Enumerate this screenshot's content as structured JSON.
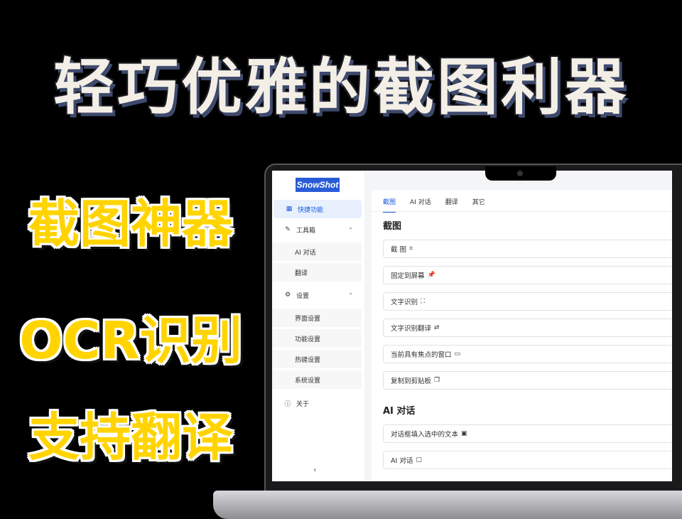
{
  "headline": "轻巧优雅的截图利器",
  "side_labels": [
    "截图神器",
    "OCR识别",
    "支持翻译"
  ],
  "app": {
    "logo": "SnowShot",
    "sidebar": {
      "items": [
        {
          "label": "快捷功能",
          "icon": "grid-icon",
          "glyph": "▦"
        },
        {
          "label": "工具箱",
          "icon": "wrench-icon",
          "glyph": "✎"
        },
        {
          "label": "AI 对话"
        },
        {
          "label": "翻译"
        },
        {
          "label": "设置",
          "icon": "gear-icon",
          "glyph": "⚙"
        },
        {
          "label": "界面设置"
        },
        {
          "label": "功能设置"
        },
        {
          "label": "热键设置"
        },
        {
          "label": "系统设置"
        },
        {
          "label": "关于",
          "icon": "info-icon",
          "glyph": "ⓘ"
        }
      ],
      "caret": "⌃",
      "collapse": "‹"
    },
    "tabs": [
      "截图",
      "AI 对话",
      "翻译",
      "其它"
    ],
    "sections": {
      "screenshot_title": "截图",
      "screenshot_rows": [
        {
          "label": "截 图",
          "glyph": "⌗"
        },
        {
          "label": "固定到屏幕",
          "glyph": "📌"
        },
        {
          "label": "文字识别",
          "glyph": "⛶"
        },
        {
          "label": "文字识别翻译",
          "glyph": "⇄"
        },
        {
          "label": "当前具有焦点的窗口",
          "glyph": "▭"
        },
        {
          "label": "复制到剪贴板",
          "glyph": "❐"
        }
      ],
      "ai_title": "AI 对话",
      "ai_rows": [
        {
          "label": "对话框填入选中的文本",
          "glyph": "▣"
        },
        {
          "label": "AI 对话",
          "glyph": "▢"
        }
      ]
    },
    "colors": {
      "accent": "#1a5ad9",
      "logo_bg": "#2a5bd7",
      "highlight": "#ffd400"
    }
  }
}
